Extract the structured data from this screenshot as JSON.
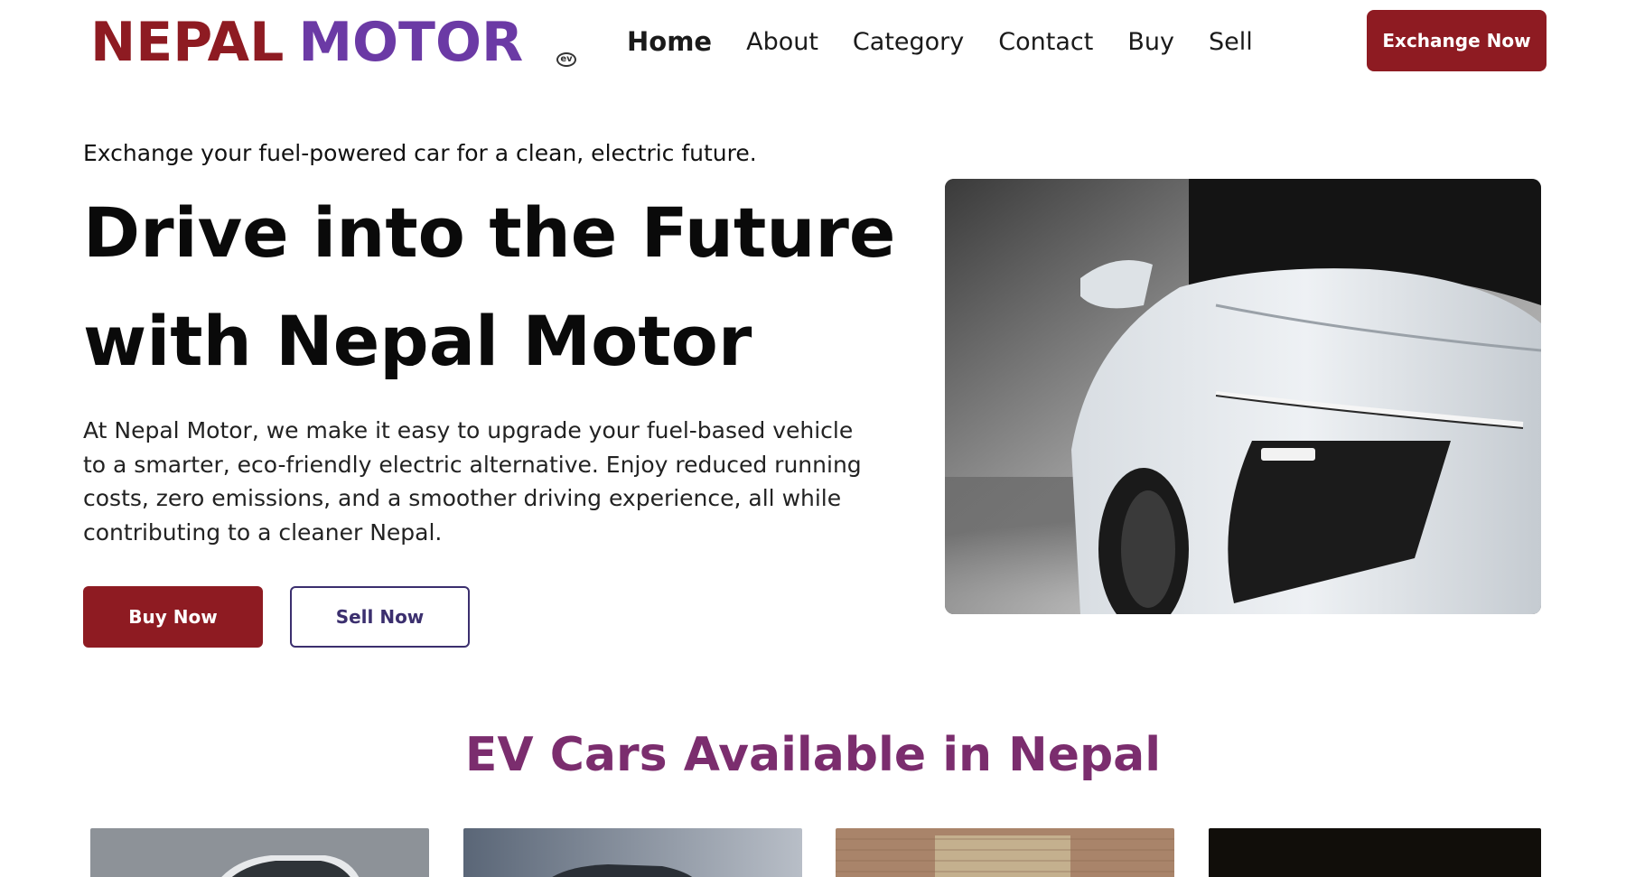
{
  "header": {
    "logo": {
      "word1": "NEPAL",
      "word2": "MOTOR",
      "badge": "ev"
    },
    "nav": [
      {
        "label": "Home",
        "active": true
      },
      {
        "label": "About"
      },
      {
        "label": "Category"
      },
      {
        "label": "Contact"
      },
      {
        "label": "Buy"
      },
      {
        "label": "Sell"
      }
    ],
    "cta_label": "Exchange Now"
  },
  "hero": {
    "tagline": "Exchange your fuel-powered car for a clean, electric future.",
    "title_line1": "Drive into the Future",
    "title_line2": "with Nepal Motor",
    "description": "At Nepal Motor, we make it easy to upgrade your fuel-based vehicle to a smarter, eco-friendly electric alternative. Enjoy reduced running costs, zero emissions, and a smoother driving experience, all while contributing to a cleaner Nepal.",
    "buy_label": "Buy Now",
    "sell_label": "Sell Now",
    "image_icon": "white-electric-car-photo"
  },
  "section": {
    "title": "EV Cars Available in Nepal",
    "cards": [
      {
        "icon": "suv-photo"
      },
      {
        "icon": "dark-car-photo"
      },
      {
        "icon": "brick-wall-car-photo"
      },
      {
        "icon": "black-car-photo"
      }
    ]
  },
  "colors": {
    "brand_red": "#8e1b22",
    "brand_purple": "#6b3aa5",
    "section_title": "#7b2d6e",
    "outline": "#3b2f6e"
  }
}
